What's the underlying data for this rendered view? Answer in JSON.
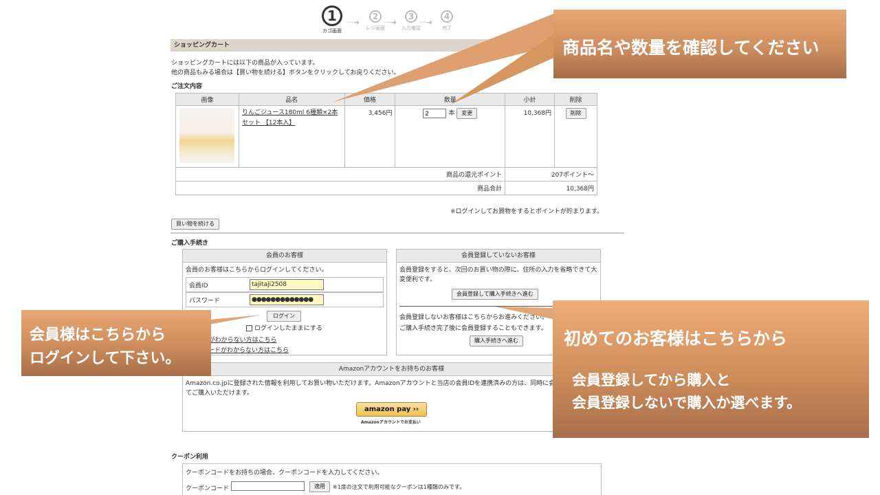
{
  "steps": [
    {
      "num": "1",
      "label": "カゴ画面",
      "active": true
    },
    {
      "num": "2",
      "label": "レジ画面",
      "active": false
    },
    {
      "num": "3",
      "label": "入力確認",
      "active": false
    },
    {
      "num": "4",
      "label": "完了",
      "active": false
    }
  ],
  "step_arrow": "····➜",
  "cart": {
    "heading": "ショッピングカート",
    "intro1": "ショッピングカートには以下の商品が入っています。",
    "intro2": "他の商品もみる場合は【買い物を続ける】ボタンをクリックしてお戻りください。",
    "order_title": "ご注文内容",
    "columns": [
      "画像",
      "品名",
      "価格",
      "数量",
      "小計",
      "削除"
    ],
    "item": {
      "name": "りんごジュース180ml 6種類×2本セット 【12本入】",
      "price": "3,456円",
      "qty": "2",
      "unit": "本",
      "change_btn": "変更",
      "subtotal": "10,368円",
      "delete_btn": "削除"
    },
    "points_label": "商品の還元ポイント",
    "points_value": "207ポイント〜",
    "total_label": "商品合計",
    "total_value": "10,368円",
    "points_note": "※ログインしてお買物をするとポイントが貯まります。",
    "continue_btn": "買い物を続ける"
  },
  "purchase": {
    "title": "ご購入手続き",
    "member": {
      "header": "会員のお客様",
      "text": "会員のお客様はこちらからログインしてください。",
      "id_label": "会員ID",
      "id_value": "tajitaji2508",
      "pw_label": "パスワード",
      "pw_value": "●●●●●●●●●●●●●",
      "login_btn": "ログイン",
      "keep_login": "ログインしたままにする",
      "forgot_id": "会員IDがわからない方はこちら",
      "forgot_pw": "パスワードがわからない方はこちら"
    },
    "guest": {
      "header": "会員登録していないお客様",
      "text1": "会員登録をすると、次回のお買い物の際に、住所の入力を省略できて大",
      "text2": "変便利です。",
      "register_btn": "会員登録して購入手続きへ進む",
      "text3": "会員登録しないお客様はこちらからお進みください。",
      "text4": "ご購入手続き完了後に会員登録することもできます。",
      "proceed_btn": "購入手続きへ進む"
    },
    "amazon": {
      "header": "Amazonアカウントをお持ちのお客様",
      "text1": "Amazon.co.jpに登録された情報を利用してお買い物いただけます。Amazonアカウントと当店の会員IDを連携済みの方は、同時に会員ログインし",
      "text2": "てご購入いただけます。",
      "btn": "amazon pay  ››",
      "caption": "Amazonアカウントでお支払い"
    }
  },
  "coupon": {
    "title": "クーポン利用",
    "text": "クーポンコードをお持ちの場合、クーポンコードを入力してください。",
    "label": "クーポンコード",
    "apply_btn": "適用",
    "note": "※1度の注文で利用可能なクーポンは1種類のみです。"
  },
  "callouts": {
    "top": "商品名や数量を確認してください",
    "login_line1": "会員様はこちらから",
    "login_line2": "ログインして下さい。",
    "guest_line1": "初めてのお客様はこちらから",
    "guest_line2": "会員登録してから購入と",
    "guest_line3": "会員登録しないで購入か選べます。"
  },
  "colors": {
    "callout": "#d4935f",
    "section_bar": "#ddd5cc",
    "input_highlight": "#fff7c2"
  }
}
